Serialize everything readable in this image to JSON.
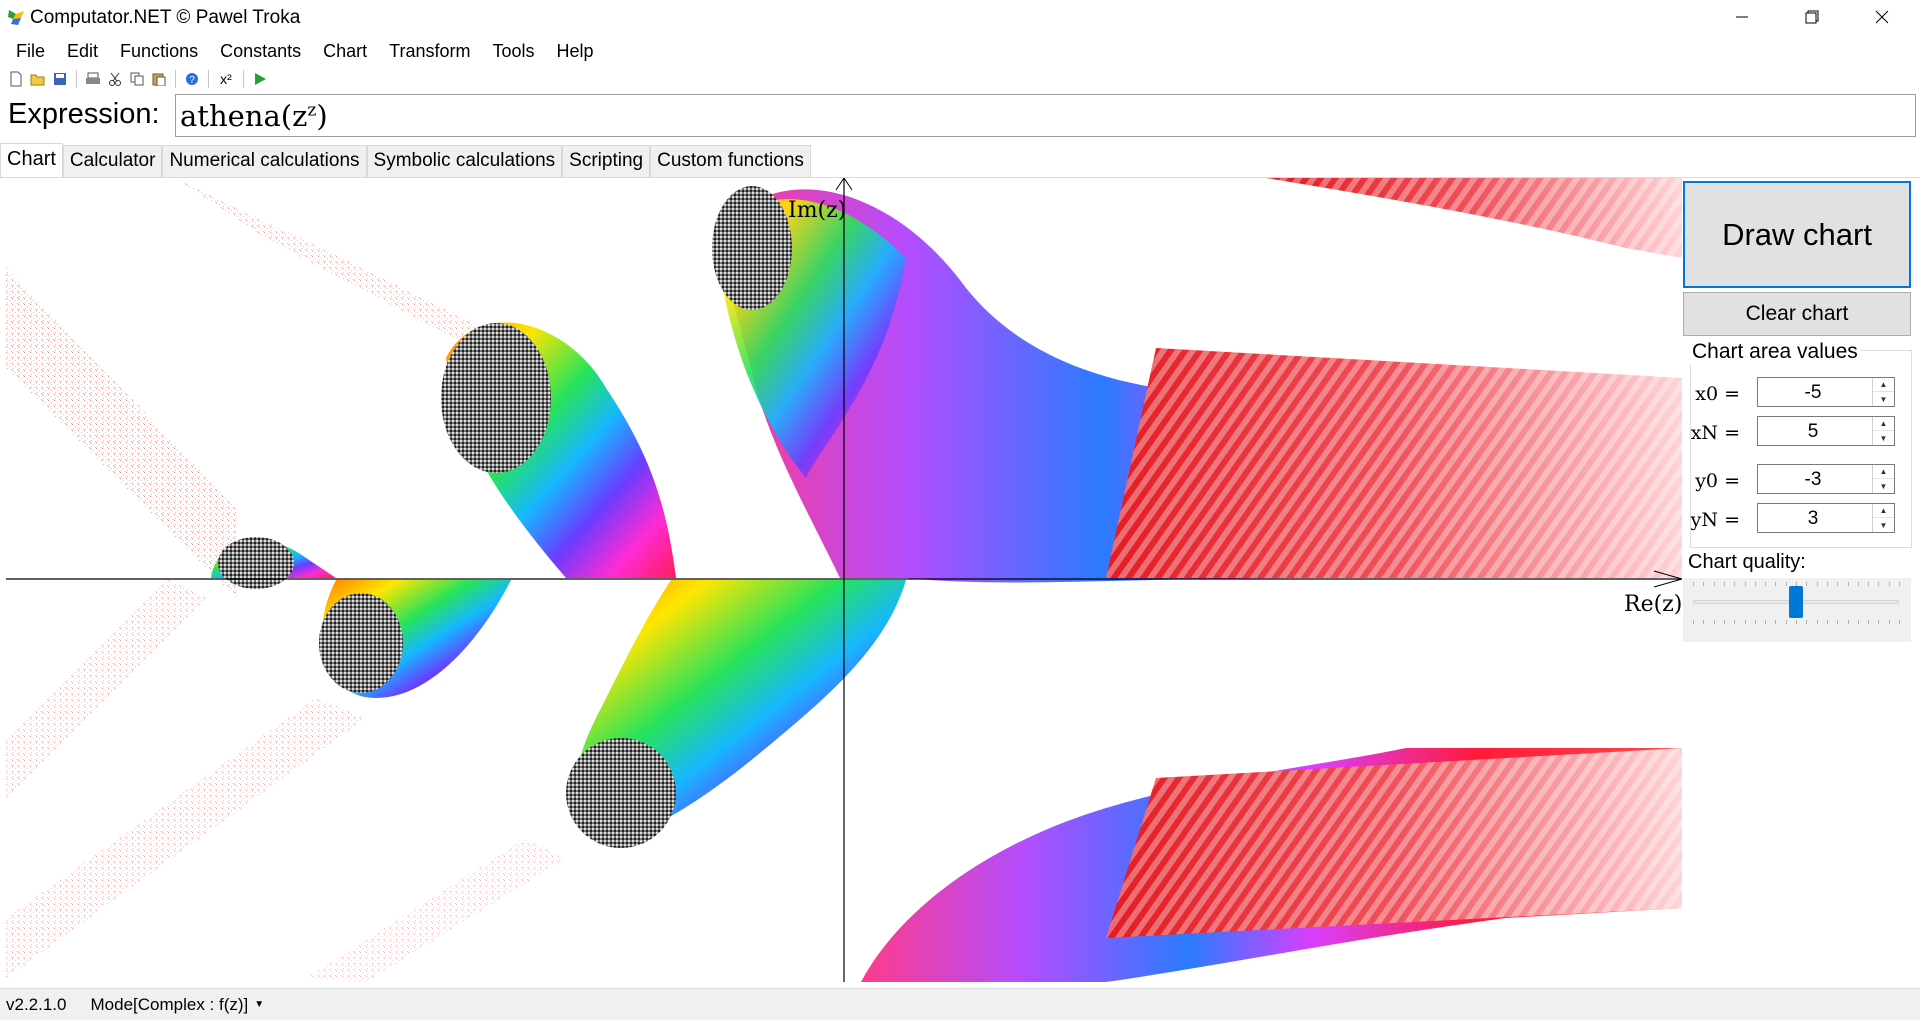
{
  "window": {
    "title": "Computator.NET © Pawel Troka",
    "icon": "app-logo-icon",
    "controls": {
      "minimize": "minimize-icon",
      "maximize": "restore-icon",
      "close": "close-icon"
    }
  },
  "menu": [
    "File",
    "Edit",
    "Functions",
    "Constants",
    "Chart",
    "Transform",
    "Tools",
    "Help"
  ],
  "toolbar": {
    "icons": [
      "new-file-icon",
      "open-folder-icon",
      "save-icon",
      "print-icon",
      "cut-icon",
      "copy-icon",
      "paste-icon",
      "help-icon",
      "exponent-icon",
      "run-icon"
    ],
    "exponent_label": "x²"
  },
  "expression": {
    "label": "Expression:",
    "value_base": "athena(z",
    "value_exponent": "z",
    "value_close": ")"
  },
  "tabs": [
    {
      "label": "Chart",
      "active": true
    },
    {
      "label": "Calculator",
      "active": false
    },
    {
      "label": "Numerical calculations",
      "active": false
    },
    {
      "label": "Symbolic calculations",
      "active": false
    },
    {
      "label": "Scripting",
      "active": false
    },
    {
      "label": "Custom functions",
      "active": false
    }
  ],
  "chart": {
    "x_axis_label": "Re(z)",
    "y_axis_label": "Im(z)",
    "x_range": [
      -5,
      5
    ],
    "y_range": [
      -3,
      3
    ],
    "coloring": "domain-coloring"
  },
  "panel": {
    "draw_button": "Draw chart",
    "clear_button": "Clear chart",
    "area_title": "Chart area values",
    "fields": [
      {
        "label": "x0 =",
        "value": "-5"
      },
      {
        "label": "xN =",
        "value": "5"
      },
      {
        "label": "y0 =",
        "value": "-3"
      },
      {
        "label": "yN =",
        "value": "3"
      }
    ],
    "quality_label": "Chart quality:",
    "quality_value": 0.5
  },
  "status": {
    "version": "v2.2.1.0",
    "mode": "Mode[Complex : f(z)]"
  }
}
